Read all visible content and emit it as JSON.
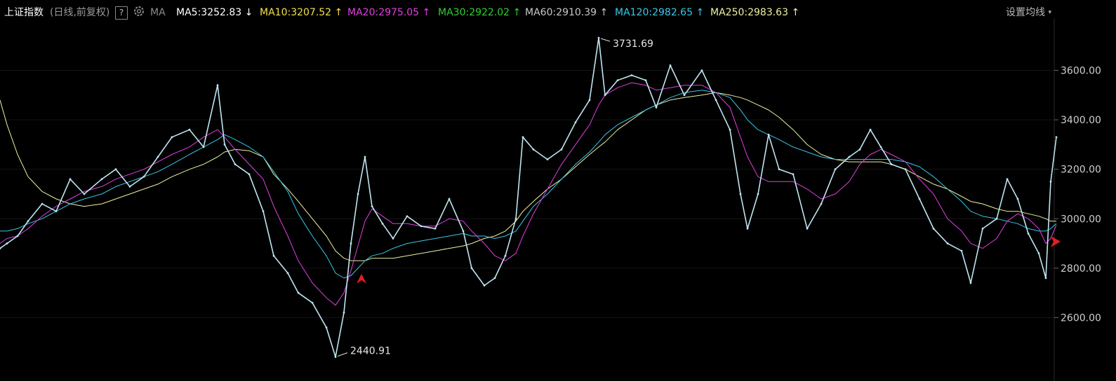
{
  "header": {
    "title": "上证指数",
    "subtitle": "(日线,前复权)",
    "help_label": "?",
    "ma_label": "MA",
    "settings_label": "设置均线",
    "ma_items": [
      {
        "name": "ma5",
        "text": "MA5:3252.83",
        "arrow": "↓",
        "color": "#ffffff"
      },
      {
        "name": "ma10",
        "text": "MA10:3207.52",
        "arrow": "↑",
        "color": "#f2e04a"
      },
      {
        "name": "ma20",
        "text": "MA20:2975.05",
        "arrow": "↑",
        "color": "#e040e0"
      },
      {
        "name": "ma30",
        "text": "MA30:2922.02",
        "arrow": "↑",
        "color": "#30d030"
      },
      {
        "name": "ma60",
        "text": "MA60:2910.39",
        "arrow": "↑",
        "color": "#c8c8c8"
      },
      {
        "name": "ma120",
        "text": "MA120:2982.65",
        "arrow": "↑",
        "color": "#38c8e8"
      },
      {
        "name": "ma250",
        "text": "MA250:2983.63",
        "arrow": "↑",
        "color": "#f0f0a0"
      }
    ]
  },
  "chart_data": {
    "type": "line",
    "ylim": [
      2420,
      3760
    ],
    "y_ticks": [
      2600,
      2800,
      3000,
      3200,
      3400,
      3600
    ],
    "y_tick_labels": [
      "2600.00",
      "2800.00",
      "3000.00",
      "3200.00",
      "3400.00",
      "3600.00"
    ],
    "annotations": [
      {
        "label": "3731.69",
        "value": 3731.69,
        "type": "high"
      },
      {
        "label": "2440.91",
        "value": 2440.91,
        "type": "low"
      }
    ],
    "x": [
      0,
      10,
      25,
      40,
      60,
      80,
      100,
      120,
      145,
      165,
      185,
      205,
      225,
      245,
      270,
      290,
      310,
      320,
      335,
      355,
      375,
      390,
      410,
      425,
      445,
      465,
      478,
      490,
      500,
      510,
      520,
      530,
      545,
      560,
      580,
      600,
      620,
      640,
      660,
      672,
      690,
      705,
      720,
      735,
      745,
      760,
      780,
      800,
      820,
      840,
      853,
      862,
      880,
      900,
      920,
      935,
      955,
      975,
      1000,
      1020,
      1040,
      1055,
      1065,
      1080,
      1095,
      1110,
      1130,
      1150,
      1170,
      1190,
      1210,
      1225,
      1240,
      1255,
      1270,
      1290,
      1310,
      1330,
      1350,
      1370,
      1383,
      1400,
      1420,
      1435,
      1450,
      1465,
      1480,
      1490,
      1497,
      1505
    ],
    "series": [
      {
        "name": "Price",
        "color": "#bfe6f2",
        "values": [
          2880,
          2900,
          2930,
          2990,
          3060,
          3030,
          3160,
          3100,
          3160,
          3200,
          3130,
          3170,
          3250,
          3330,
          3360,
          3290,
          3540,
          3300,
          3220,
          3180,
          3030,
          2850,
          2780,
          2700,
          2660,
          2560,
          2440.91,
          2620,
          2900,
          3100,
          3250,
          3050,
          2980,
          2920,
          3010,
          2970,
          2960,
          3080,
          2950,
          2800,
          2730,
          2760,
          2850,
          3000,
          3330,
          3280,
          3240,
          3280,
          3390,
          3480,
          3731.69,
          3500,
          3560,
          3580,
          3560,
          3450,
          3620,
          3500,
          3600,
          3480,
          3360,
          3100,
          2960,
          3100,
          3340,
          3200,
          3180,
          2960,
          3060,
          3200,
          3250,
          3280,
          3360,
          3290,
          3220,
          3200,
          3080,
          2960,
          2900,
          2870,
          2740,
          2960,
          3000,
          3160,
          3080,
          2940,
          2860,
          2760,
          3150,
          3330
        ]
      },
      {
        "name": "MA250",
        "color": "#f0f0a0",
        "values": [
          3480,
          3380,
          3260,
          3170,
          3110,
          3080,
          3060,
          3050,
          3060,
          3080,
          3100,
          3120,
          3140,
          3170,
          3200,
          3220,
          3250,
          3270,
          3280,
          3275,
          3250,
          3180,
          3120,
          3070,
          3000,
          2930,
          2870,
          2840,
          2830,
          2830,
          2830,
          2840,
          2840,
          2840,
          2850,
          2860,
          2870,
          2880,
          2890,
          2900,
          2920,
          2930,
          2950,
          2990,
          3030,
          3070,
          3120,
          3160,
          3210,
          3260,
          3290,
          3310,
          3360,
          3400,
          3440,
          3460,
          3480,
          3490,
          3500,
          3510,
          3500,
          3490,
          3480,
          3460,
          3440,
          3410,
          3360,
          3300,
          3260,
          3240,
          3230,
          3230,
          3230,
          3230,
          3220,
          3200,
          3170,
          3140,
          3120,
          3090,
          3070,
          3060,
          3040,
          3030,
          3030,
          3020,
          3010,
          3000,
          2990,
          2990
        ]
      },
      {
        "name": "MA120",
        "color": "#38c8e8",
        "values": [
          2950,
          2950,
          2960,
          2980,
          3000,
          3030,
          3060,
          3080,
          3100,
          3130,
          3150,
          3170,
          3190,
          3220,
          3260,
          3290,
          3320,
          3340,
          3320,
          3290,
          3250,
          3190,
          3110,
          3020,
          2930,
          2850,
          2780,
          2760,
          2770,
          2800,
          2830,
          2850,
          2860,
          2880,
          2900,
          2910,
          2920,
          2930,
          2940,
          2930,
          2930,
          2920,
          2930,
          2950,
          2990,
          3050,
          3100,
          3160,
          3220,
          3270,
          3310,
          3340,
          3380,
          3410,
          3440,
          3460,
          3490,
          3510,
          3520,
          3510,
          3490,
          3440,
          3400,
          3360,
          3340,
          3320,
          3290,
          3270,
          3250,
          3240,
          3240,
          3240,
          3240,
          3240,
          3240,
          3230,
          3210,
          3170,
          3120,
          3070,
          3030,
          3010,
          3000,
          2990,
          2980,
          2960,
          2950,
          2950,
          2960,
          2980
        ]
      },
      {
        "name": "MA20",
        "color": "#e040e0",
        "values": [
          2900,
          2920,
          2930,
          2960,
          3010,
          3050,
          3080,
          3110,
          3130,
          3160,
          3180,
          3200,
          3230,
          3260,
          3290,
          3330,
          3360,
          3330,
          3280,
          3220,
          3160,
          3050,
          2930,
          2830,
          2740,
          2680,
          2650,
          2700,
          2790,
          2890,
          2990,
          3040,
          3010,
          2980,
          2980,
          2970,
          2970,
          3000,
          2990,
          2950,
          2900,
          2850,
          2830,
          2860,
          2930,
          3020,
          3120,
          3220,
          3300,
          3380,
          3460,
          3500,
          3530,
          3550,
          3540,
          3520,
          3530,
          3540,
          3540,
          3510,
          3450,
          3330,
          3250,
          3170,
          3150,
          3150,
          3150,
          3120,
          3080,
          3100,
          3150,
          3220,
          3260,
          3280,
          3260,
          3230,
          3160,
          3100,
          3000,
          2950,
          2900,
          2880,
          2920,
          2990,
          3020,
          3000,
          2960,
          2900,
          2920,
          2975.05
        ]
      }
    ]
  }
}
